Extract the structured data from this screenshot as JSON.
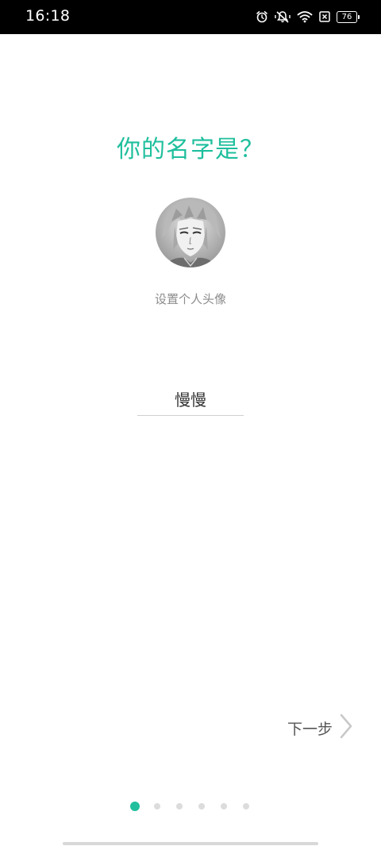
{
  "status_bar": {
    "time": "16:18",
    "battery": "76",
    "icons": [
      "alarm-icon",
      "mute-icon",
      "wifi-icon",
      "no-sim-icon",
      "battery-icon"
    ]
  },
  "title": "你的名字是？",
  "avatar": {
    "label": "设置个人头像"
  },
  "name_field": {
    "value": "慢慢"
  },
  "next": {
    "label": "下一步",
    "icon": "chevron-right-icon"
  },
  "pager": {
    "count": 6,
    "active_index": 0
  },
  "colors": {
    "accent": "#1fbf9d",
    "status_bar_bg": "#000000"
  }
}
